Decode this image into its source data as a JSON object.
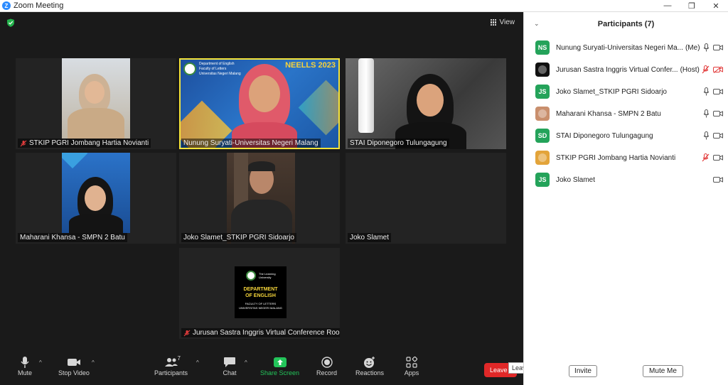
{
  "window": {
    "title": "Zoom Meeting",
    "minimize": "—",
    "maximize": "❐",
    "close": "✕"
  },
  "meeting": {
    "view_label": "View",
    "tiles": [
      {
        "name": "STKIP PGRI Jombang Hartia Novianti",
        "muted": true
      },
      {
        "name": "Nunung Suryati-Universitas Negeri Malang",
        "muted": false,
        "active": true
      },
      {
        "name": "STAI Diponegoro Tulungagung",
        "muted": false
      },
      {
        "name": "Maharani Khansa - SMPN 2 Batu",
        "muted": false
      },
      {
        "name": "Joko Slamet_STKIP PGRI Sidoarjo",
        "muted": false
      },
      {
        "name": "Joko Slamet",
        "muted": false
      },
      {
        "name": "Jurusan Sastra Inggris Virtual Conference Room",
        "muted": true
      }
    ],
    "banner": {
      "dept_line1": "Department of English",
      "dept_line2": "Faculty of Letters",
      "dept_line3": "Universitas Negeri Malang",
      "event": "NEELLS 2023"
    },
    "logo_card": {
      "brand": "The Learning University",
      "line1": "DEPARTMENT",
      "line2": "OF ENGLISH",
      "line3": "FACULTY OF LETTERS",
      "line4": "UNIVERSITAS NEGERI MALANG"
    }
  },
  "controls": {
    "mute": "Mute",
    "stop_video": "Stop Video",
    "participants": "Participants",
    "participants_count": "7",
    "chat": "Chat",
    "share_screen": "Share Screen",
    "record": "Record",
    "reactions": "Reactions",
    "apps": "Apps",
    "leave": "Leave",
    "leave_tooltip": "Leave (Alt+Q)",
    "caret": "^"
  },
  "panel": {
    "title": "Participants (7)",
    "collapse": "⌄",
    "participants": [
      {
        "initials": "NS",
        "color": "#24a35a",
        "name": "Nunung Suryati-Universitas Negeri Ma...",
        "role": "(Me)",
        "mic": "on",
        "video": "on"
      },
      {
        "initials": "",
        "color": "#111111",
        "name": "Jurusan Sastra Inggris Virtual Confer...",
        "role": "(Host)",
        "mic": "off",
        "video": "off"
      },
      {
        "initials": "JS",
        "color": "#24a35a",
        "name": "Joko Slamet_STKIP PGRI Sidoarjo",
        "role": "",
        "mic": "on",
        "video": "on"
      },
      {
        "initials": "",
        "color": "#c98f6d",
        "name": "Maharani Khansa - SMPN 2 Batu",
        "role": "",
        "mic": "on",
        "video": "on"
      },
      {
        "initials": "SD",
        "color": "#24a35a",
        "name": "STAI Diponegoro Tulungagung",
        "role": "",
        "mic": "on",
        "video": "on"
      },
      {
        "initials": "",
        "color": "#e3a43a",
        "name": "STKIP PGRI Jombang Hartia Novianti",
        "role": "",
        "mic": "off",
        "video": "on"
      },
      {
        "initials": "JS",
        "color": "#24a35a",
        "name": "Joko Slamet",
        "role": "",
        "mic": "none",
        "video": "on"
      }
    ],
    "invite": "Invite",
    "mute_me": "Mute Me"
  }
}
